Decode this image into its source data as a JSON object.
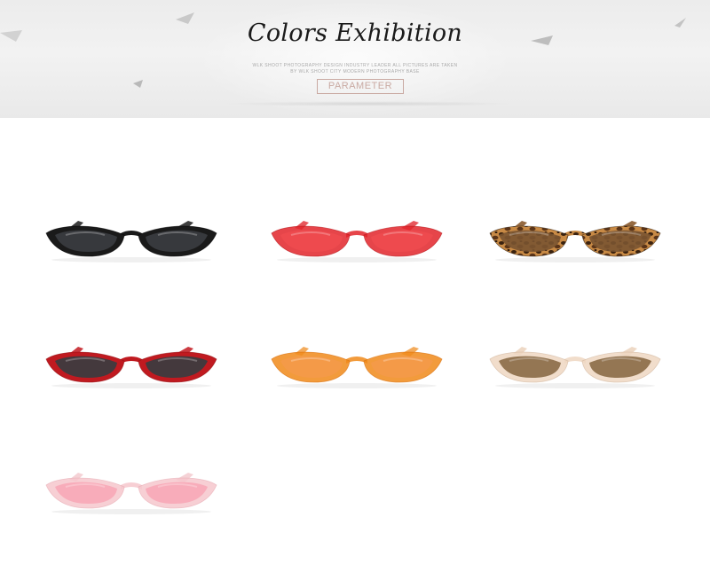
{
  "banner": {
    "title": "Colors Exhibition",
    "subtitle_line1": "WLK SHOOT PHOTOGRAPHY DESIGN INDUSTRY LEADER ALL PICTURES ARE TAKEN",
    "subtitle_line2": "BY WLK SHOOT CITY MODERN PHOTOGRAPHY BASE",
    "parameter_label": "PARAMETER"
  },
  "products": [
    {
      "name": "black-frame-grey-lens",
      "frame": "#1a1a1a",
      "frame_dark": "#000000",
      "lens": "#3a3c40",
      "lens_opacity": 0.92,
      "temple": "#2a2a2a",
      "pattern": "solid"
    },
    {
      "name": "red-frame-red-lens",
      "frame": "#e2242a",
      "frame_dark": "#b31217",
      "lens": "#ef4b4f",
      "lens_opacity": 0.85,
      "temple": "#e4454a",
      "pattern": "clear"
    },
    {
      "name": "leopard-frame-brown-lens",
      "frame": "#6b4222",
      "frame_dark": "#2b1a0c",
      "lens": "#7a5431",
      "lens_opacity": 0.9,
      "temple": "#8a5a2e",
      "pattern": "tortoise"
    },
    {
      "name": "wine-frame-grey-lens",
      "frame": "#c01a20",
      "frame_dark": "#8f0f13",
      "lens": "#3a3c40",
      "lens_opacity": 0.92,
      "temple": "#c6262c",
      "pattern": "solid"
    },
    {
      "name": "orange-frame-orange-lens",
      "frame": "#f08a1a",
      "frame_dark": "#d56a08",
      "lens": "#f49a4a",
      "lens_opacity": 0.85,
      "temple": "#f2a24a",
      "pattern": "clear"
    },
    {
      "name": "clear-frame-tea-lens",
      "frame": "#efd7c2",
      "frame_dark": "#cfb29a",
      "lens": "#8a6a46",
      "lens_opacity": 0.9,
      "temple": "#ecd5c0",
      "pattern": "clear"
    },
    {
      "name": "pink-frame-pink-lens",
      "frame": "#f6c7cc",
      "frame_dark": "#e6a9b0",
      "lens": "#f7a3b3",
      "lens_opacity": 0.8,
      "temple": "#f4cdd1",
      "pattern": "clear"
    }
  ]
}
